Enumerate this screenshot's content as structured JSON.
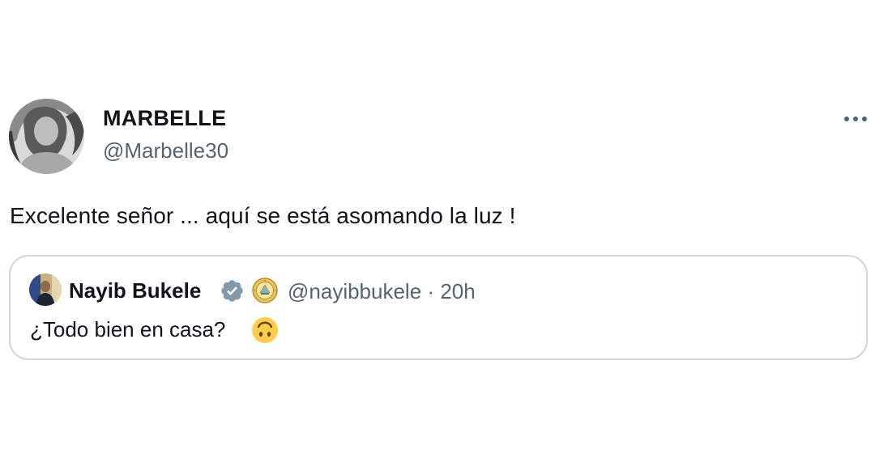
{
  "tweet": {
    "display_name": "MARBELLE",
    "handle": "@Marbelle30",
    "text": "Excelente señor ... aquí se está asomando la luz !",
    "more_icon": "more-horizontal-icon"
  },
  "quote": {
    "display_name": "Nayib Bukele",
    "handle": "@nayibbukele",
    "separator": "·",
    "time": "20h",
    "text": "¿Todo bien en casa?",
    "verified_icon": "verified-badge-icon",
    "affiliate_icon": "government-seal-icon",
    "emoji_icon": "upside-down-face-emoji",
    "verified_color": "#829aab"
  },
  "colors": {
    "text_primary": "#0f1419",
    "text_secondary": "#536471",
    "border": "#cfd9de",
    "background": "#ffffff"
  }
}
